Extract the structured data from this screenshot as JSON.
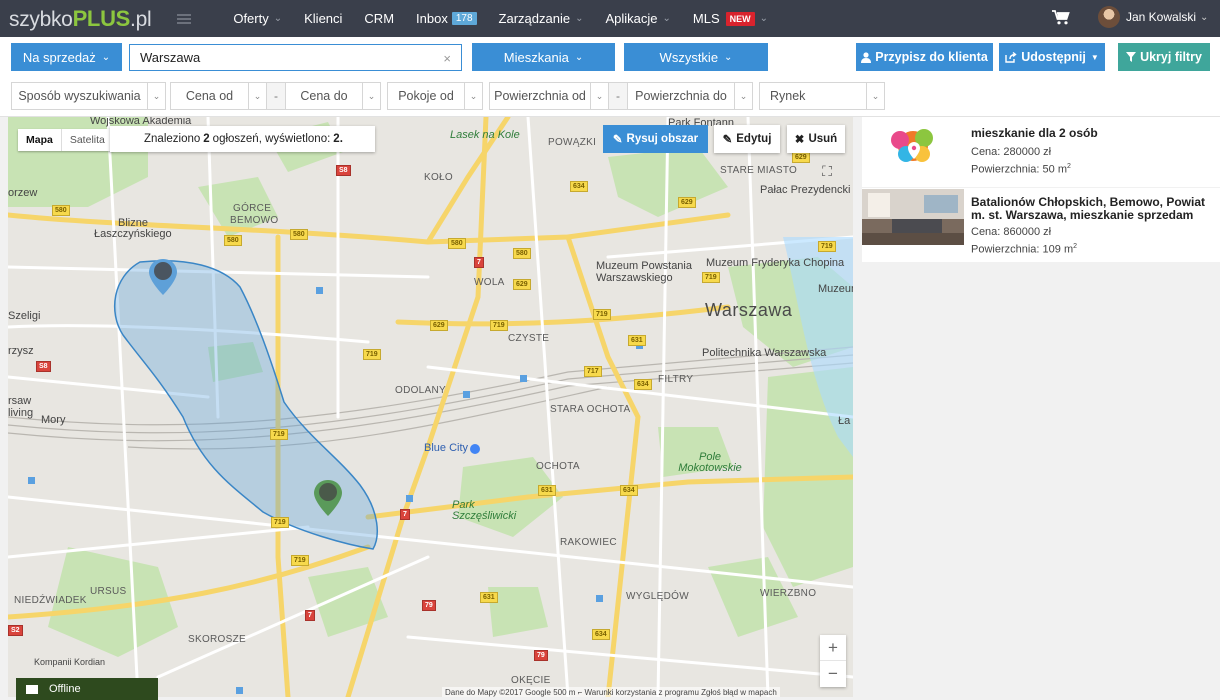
{
  "nav": {
    "logo_prefix": "szybko",
    "logo_brand": "PLUS",
    "logo_suffix": ".pl",
    "items": [
      {
        "label": "Oferty",
        "has_dropdown": true
      },
      {
        "label": "Klienci",
        "has_dropdown": false
      },
      {
        "label": "CRM",
        "has_dropdown": false
      },
      {
        "label": "Inbox",
        "badge": "178",
        "has_dropdown": false
      },
      {
        "label": "Zarządzanie",
        "has_dropdown": true
      },
      {
        "label": "Aplikacje",
        "has_dropdown": true
      },
      {
        "label": "MLS",
        "badge_new": "NEW",
        "has_dropdown": true
      }
    ],
    "user_name": "Jan Kowalski"
  },
  "filters_top": {
    "transaction": "Na sprzedaż",
    "city": "Warszawa",
    "clear_symbol": "×",
    "property_type": "Mieszkania",
    "scope": "Wszystkie",
    "assign_button": "Przypisz do klienta",
    "share_button": "Udostępnij",
    "hide_filters_button": "Ukryj filtry"
  },
  "filters_bottom": {
    "search_mode": "Sposób wyszukiwania",
    "price_from": "Cena od",
    "range_dash": "-",
    "price_to": "Cena do",
    "rooms_from": "Pokoje od",
    "area_from": "Powierzchnia od",
    "area_to": "Powierzchnia do",
    "market": "Rynek"
  },
  "map": {
    "type_map": "Mapa",
    "type_satellite": "Satelita",
    "found_prefix": "Znaleziono",
    "found_count": "2",
    "found_middle": "ogłoszeń, wyświetlono:",
    "shown_count": "2.",
    "draw_area": "Rysuj obszar",
    "edit": "Edytuj",
    "remove": "Usuń",
    "zoom_in": "+",
    "zoom_out": "−",
    "attribution": "Dane do Mapy ©2017 Google   500 m ⌐   Warunki korzystania z programu   Zgłoś błąd w mapach",
    "labels": {
      "city": "Warszawa",
      "wojskowa": "Wojskowa Akademia",
      "powazki": "POWĄZKI",
      "lasek": "Lasek na Kole",
      "park_fontan": "Park Fontann",
      "stare_miasto": "STARE MIASTO",
      "palac": "Pałac Prezydencki",
      "kolo": "KOŁO",
      "gorce": "GÓRCE",
      "bemowo": "BEMOWO",
      "blizne": "Blizne",
      "laszczynskiego": "Łaszczyńskiego",
      "orzew": "orzew",
      "wola": "WOLA",
      "muzeum_powstania": "Muzeum Powstania",
      "warszawskiego": "Warszawskiego",
      "muzeum_chopina": "Muzeum Fryderyka Chopina",
      "muzeum_wwar": "Muzeum w War",
      "szeligi": "Szeligi",
      "czyste": "CZYSTE",
      "politechnika": "Politechnika Warszawska",
      "rzysz": "rzysz",
      "odolany": "ODOLANY",
      "filtry": "FILTRY",
      "rsaw": "rsaw",
      "living": "living",
      "mory": "Mory",
      "stara_ochota": "STARA OCHOTA",
      "blue_city": "Blue City",
      "ochota": "OCHOTA",
      "pole_mokotowskie": "Pole Mokotowskie",
      "park_szczesliwicki": "Park Szczęśliwicki",
      "rakowiec": "RAKOWIEC",
      "ursus": "URSUS",
      "niedzwiadek": "NIEDŹWIADEK",
      "wieliczki": "WIERZBNO",
      "wygledow": "WYGLĘDÓW",
      "skorosze": "SKOROSZE",
      "okecie": "OKĘCIE",
      "lazienki": "Ła Kró",
      "kompani": "Kompanii Kordian"
    }
  },
  "results": [
    {
      "title": "mieszkanie dla 2 osób",
      "price_label": "Cena: 280000 zł",
      "area_label": "Powierzchnia: 50 m",
      "unit_sup": "2"
    },
    {
      "title": "Batalionów Chłopskich, Bemowo, Powiat m. st. Warszawa, mieszkanie sprzedam",
      "price_label": "Cena: 860000 zł",
      "area_label": "Powierzchnia: 109 m",
      "unit_sup": "2"
    }
  ],
  "chat": {
    "status": "Offline"
  },
  "colors": {
    "nav_bg": "#3a3f4b",
    "primary": "#3a8ed5",
    "accent_green": "#3fa69b",
    "brand_green": "#8cc63f",
    "new_badge": "#d9232d",
    "polygon": "#3a8ed5"
  }
}
